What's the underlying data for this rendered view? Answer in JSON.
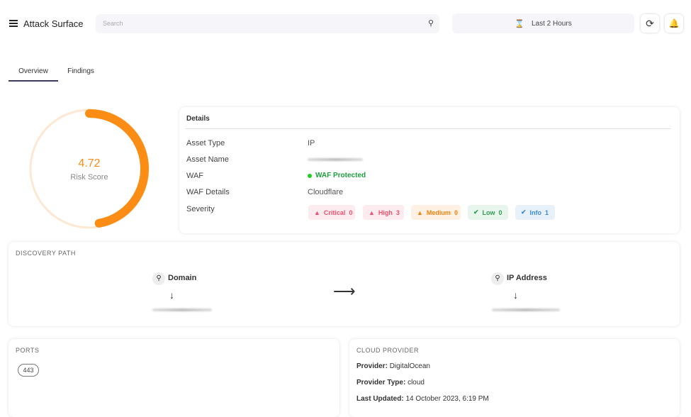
{
  "header": {
    "title": "Attack Surface",
    "search_placeholder": "Search",
    "time_range": "Last 2 Hours"
  },
  "tabs": [
    {
      "label": "Overview",
      "active": true
    },
    {
      "label": "Findings",
      "active": false
    }
  ],
  "risk": {
    "score": "4.72",
    "label": "Risk Score",
    "fraction": 0.472,
    "color": "#fb8c14"
  },
  "details": {
    "title": "Details",
    "rows": [
      {
        "label": "Asset Type",
        "value": "IP"
      },
      {
        "label": "Asset Name",
        "value": ""
      },
      {
        "label": "WAF",
        "value": "WAF Protected"
      },
      {
        "label": "WAF Details",
        "value": "Cloudflare"
      },
      {
        "label": "Severity",
        "value": ""
      }
    ],
    "severity": [
      {
        "label": "Critical",
        "count": "0",
        "color": "#f0506e",
        "bg": "#fdecef"
      },
      {
        "label": "High",
        "count": "3",
        "color": "#f0506e",
        "bg": "#fdecef"
      },
      {
        "label": "Medium",
        "count": "0",
        "color": "#f5820d",
        "bg": "#fef1e4"
      },
      {
        "label": "Low",
        "count": "0",
        "color": "#2e9e4f",
        "bg": "#e8f5ec"
      },
      {
        "label": "Info",
        "count": "1",
        "color": "#3a8bd0",
        "bg": "#e8f1fa"
      }
    ]
  },
  "discovery": {
    "title": "Discovery Path",
    "from": "Domain",
    "to": "IP Address"
  },
  "ports": {
    "title": "Ports",
    "items": [
      "443"
    ]
  },
  "cloud": {
    "title": "Cloud Provider",
    "provider_label": "Provider:",
    "provider": "DigitalOcean",
    "type_label": "Provider Type:",
    "type": "cloud",
    "updated_label": "Last Updated:",
    "updated": "14 October 2023, 6:19 PM"
  }
}
